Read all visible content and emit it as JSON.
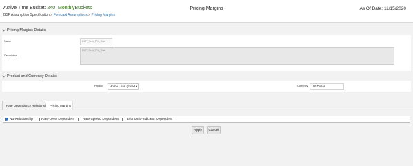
{
  "header": {
    "bucket_label": "Active Time Bucket:",
    "bucket_value": "240_MonthlyBuckets",
    "breadcrumb": {
      "root": "BSP Assumption Specification",
      "separator": ">",
      "items": [
        "Forecast Assumptions",
        "Pricing Margins"
      ]
    },
    "title": "Pricing Margins",
    "as_of_label": "As Of Date:",
    "as_of_value": "11/15/2020"
  },
  "pricing_margins_details": {
    "heading": "Pricing Margins Details",
    "name_label": "Name",
    "name_value": "BSP_Test_PM_Rule",
    "description_label": "Description",
    "description_value": "BSP_Test_PM_Rule"
  },
  "product_currency_details": {
    "heading": "Product and Currency Details",
    "product_label": "Product",
    "product_value": "Home Loan (Fixed",
    "currency_label": "Currency",
    "currency_value": "US Dollar"
  },
  "tabs": [
    {
      "label": "Rate Dependency Relationships",
      "active": true
    },
    {
      "label": "Pricing Margins",
      "active": false
    }
  ],
  "dependency_options": [
    {
      "label": "No Relationship",
      "checked": true
    },
    {
      "label": "Rate-Level Dependent",
      "checked": false
    },
    {
      "label": "Rate-Spread Dependent",
      "checked": false
    },
    {
      "label": "Economic-Indicator Dependent",
      "checked": false
    }
  ],
  "buttons": {
    "apply": "Apply",
    "cancel": "Cancel"
  },
  "colors": {
    "bucket_value": "#2a6a10",
    "link": "#2d6a9f",
    "checked": "#2f6fc4"
  },
  "icons": {
    "section_toggle": "chevron-down-icon"
  }
}
